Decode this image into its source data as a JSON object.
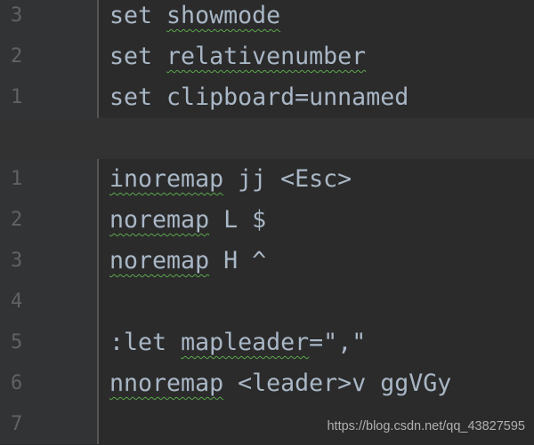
{
  "lines": [
    {
      "num": "3",
      "segments": [
        {
          "text": "set ",
          "sq": false
        },
        {
          "text": "showmode",
          "sq": true
        }
      ]
    },
    {
      "num": "2",
      "segments": [
        {
          "text": "set ",
          "sq": false
        },
        {
          "text": "relativenumber",
          "sq": true
        }
      ]
    },
    {
      "num": "1",
      "segments": [
        {
          "text": "set clipboard=unnamed",
          "sq": false
        }
      ]
    },
    {
      "num": "",
      "current": true,
      "segments": []
    },
    {
      "num": "1",
      "segments": [
        {
          "text": "inoremap",
          "sq": true
        },
        {
          "text": " jj <Esc>",
          "sq": false
        }
      ]
    },
    {
      "num": "2",
      "segments": [
        {
          "text": "noremap",
          "sq": true
        },
        {
          "text": " L $",
          "sq": false
        }
      ]
    },
    {
      "num": "3",
      "segments": [
        {
          "text": "noremap",
          "sq": true
        },
        {
          "text": " H ^",
          "sq": false
        }
      ]
    },
    {
      "num": "4",
      "segments": []
    },
    {
      "num": "5",
      "segments": [
        {
          "text": ":let ",
          "sq": false
        },
        {
          "text": "mapleader",
          "sq": true
        },
        {
          "text": "=\",\"",
          "sq": false
        }
      ]
    },
    {
      "num": "6",
      "segments": [
        {
          "text": "nnoremap",
          "sq": true
        },
        {
          "text": " <leader>v ggVGy",
          "sq": false
        }
      ]
    },
    {
      "num": "7",
      "segments": []
    }
  ],
  "watermark": "https://blog.csdn.net/qq_43827595"
}
